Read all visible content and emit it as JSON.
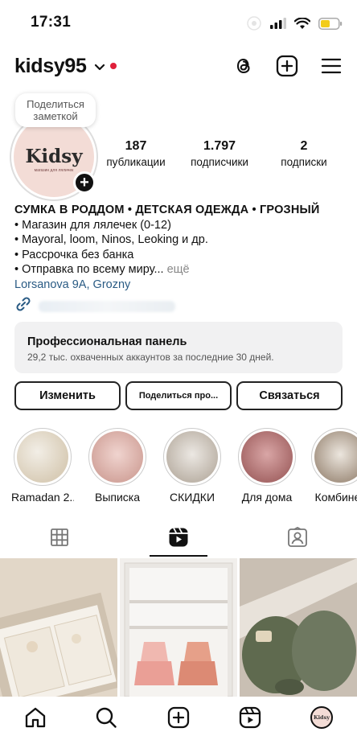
{
  "status_bar": {
    "time": "17:31"
  },
  "header": {
    "username": "kidsy95",
    "icons": [
      "threads-icon",
      "create-plus-icon",
      "menu-icon"
    ]
  },
  "profile": {
    "note_bubble": "Поделиться заметкой",
    "avatar_logo": "Kidsy",
    "avatar_caption": "магазин для ляличек",
    "stats": [
      {
        "value": "187",
        "label": "публикации"
      },
      {
        "value": "1.797",
        "label": "подписчики"
      },
      {
        "value": "2",
        "label": "подписки"
      }
    ]
  },
  "bio": {
    "title": "СУМКА В РОДДОМ • ДЕТСКАЯ ОДЕЖДА • ГРОЗНЫЙ",
    "lines": [
      "• Магазин для лялечек (0-12)",
      "• Mayoral, loom, Ninos, Leoking и др.",
      "• Рассрочка без банка",
      "• Отправка по всему миру..."
    ],
    "more": "ещё",
    "location": "Lorsanova 9A, Grozny"
  },
  "pro_panel": {
    "title": "Профессиональная панель",
    "subtitle": "29,2 тыс. охваченных аккаунтов за последние 30 дней."
  },
  "actions": {
    "edit": "Изменить",
    "share": "Поделиться про...",
    "contact": "Связаться"
  },
  "highlights": [
    {
      "label": "Ramadan 2...",
      "color": "#e8e2d8"
    },
    {
      "label": "Выписка",
      "color": "#e8c9c4"
    },
    {
      "label": "СКИДКИ",
      "color": "#dcd6cf"
    },
    {
      "label": "Для дома",
      "color": "#c98e8e"
    },
    {
      "label": "Комбинез",
      "color": "#c9c2b8"
    }
  ],
  "tabs": [
    "grid-icon",
    "reels-icon",
    "tagged-icon"
  ],
  "grid": [
    {
      "description": "gift box",
      "color": "#d9cfc2"
    },
    {
      "description": "shelf",
      "color": "#e7e5e2"
    },
    {
      "description": "knit set",
      "color": "#6b735c"
    }
  ],
  "bottom_nav": {
    "items": [
      "home-icon",
      "search-icon",
      "create-icon",
      "reels-icon",
      "profile-avatar"
    ],
    "avatar_text": "Kidsy"
  }
}
